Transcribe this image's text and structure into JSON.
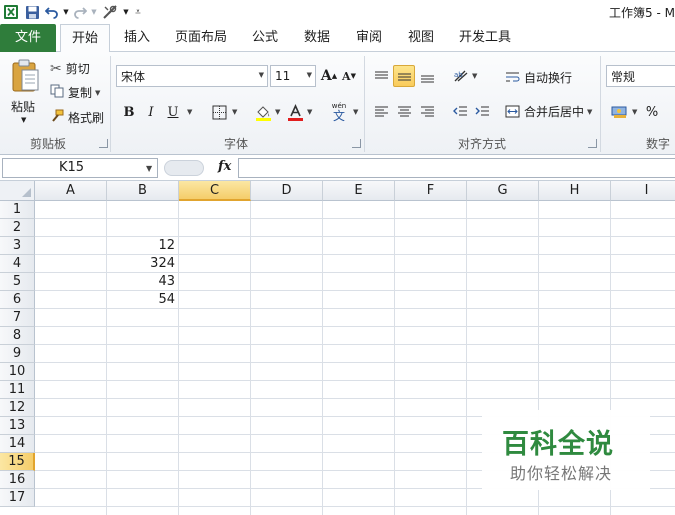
{
  "window": {
    "title": "工作簿5 - M"
  },
  "tabs": [
    {
      "label": "文件"
    },
    {
      "label": "开始"
    },
    {
      "label": "插入"
    },
    {
      "label": "页面布局"
    },
    {
      "label": "公式"
    },
    {
      "label": "数据"
    },
    {
      "label": "审阅"
    },
    {
      "label": "视图"
    },
    {
      "label": "开发工具"
    }
  ],
  "ribbon": {
    "clipboard": {
      "label": "剪贴板",
      "paste": "粘贴",
      "cut": "剪切",
      "copy": "复制",
      "format_painter": "格式刷"
    },
    "font": {
      "label": "字体",
      "font_name": "宋体",
      "font_size": "11",
      "bold": "B",
      "italic": "I",
      "underline": "U",
      "grow": "A",
      "shrink": "A",
      "phonetic": "wén",
      "phonetic_char": "文"
    },
    "alignment": {
      "label": "对齐方式",
      "wrap_text": "自动换行",
      "merge_center": "合并后居中"
    },
    "number": {
      "label": "数字",
      "format": "常规",
      "percent": "%"
    }
  },
  "formula_bar": {
    "name_box": "K15",
    "fx": "fx",
    "value": ""
  },
  "sheet": {
    "columns": [
      "A",
      "B",
      "C",
      "D",
      "E",
      "F",
      "G",
      "H",
      "I"
    ],
    "active_column": "C",
    "rows": [
      "1",
      "2",
      "3",
      "4",
      "5",
      "6",
      "7",
      "8",
      "9",
      "10",
      "11",
      "12",
      "13",
      "14",
      "15",
      "16",
      "17"
    ],
    "active_row": "15",
    "cells": [
      {
        "ref": "B3",
        "value": "12"
      },
      {
        "ref": "B4",
        "value": "324"
      },
      {
        "ref": "B5",
        "value": "43"
      },
      {
        "ref": "B6",
        "value": "54"
      }
    ]
  },
  "watermark": {
    "title": "百科全说",
    "subtitle": "助你轻松解决"
  },
  "colors": {
    "file_tab": "#2f7d3b",
    "selected_header": "#f5cd6a",
    "watermark": "#2f8a3f"
  }
}
